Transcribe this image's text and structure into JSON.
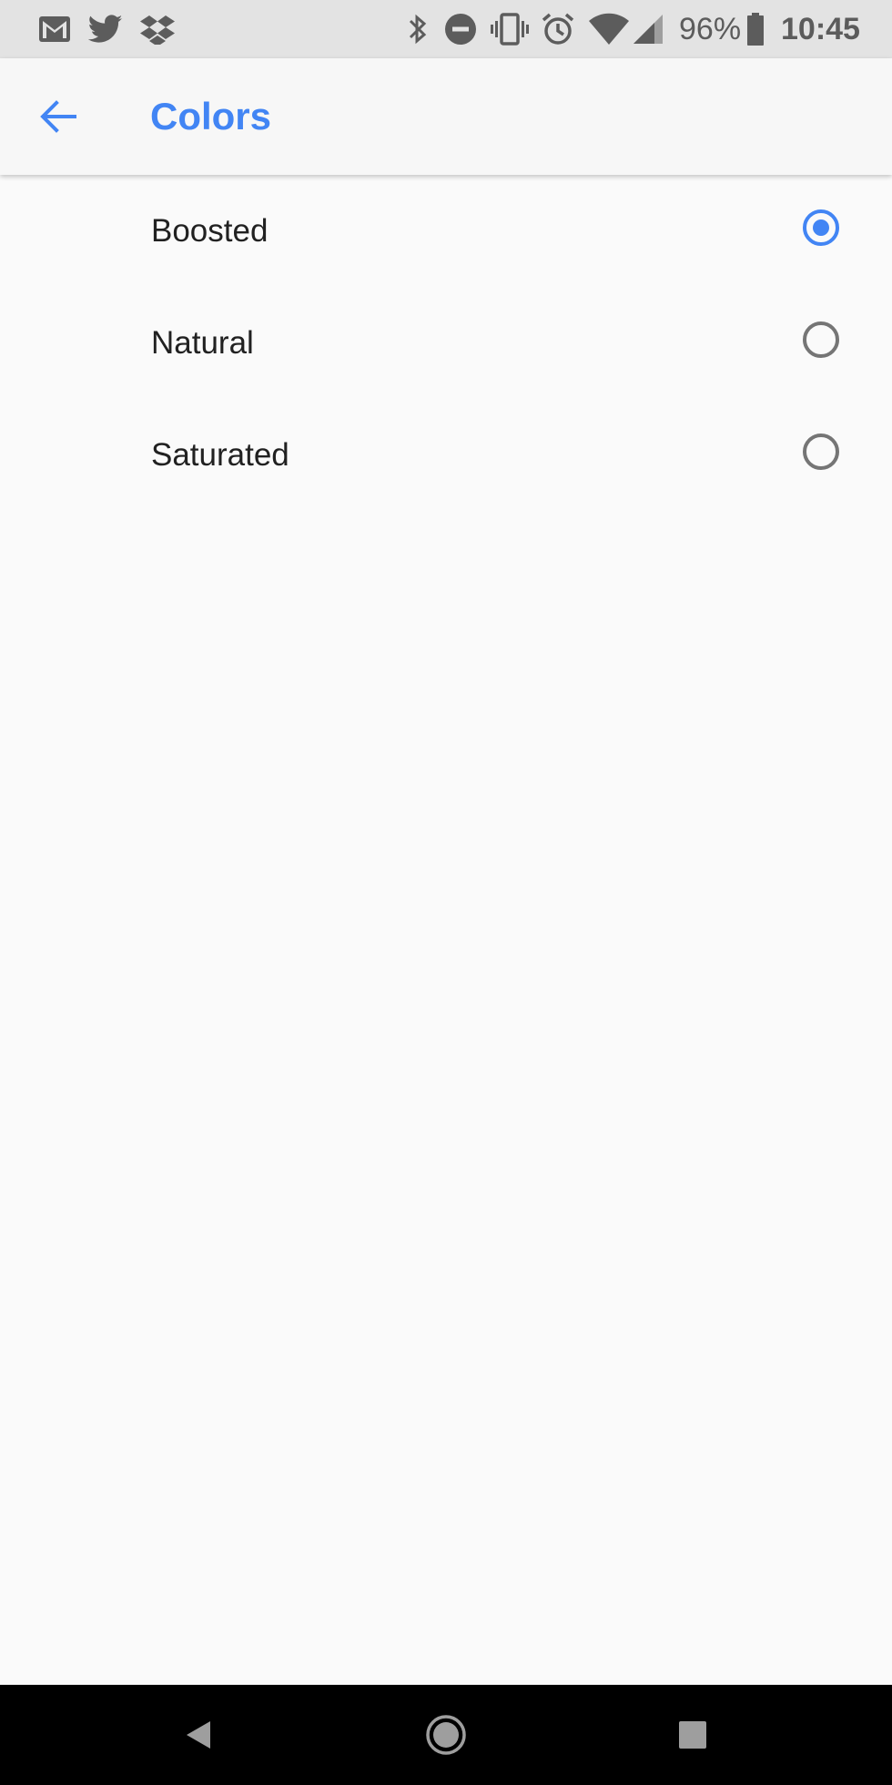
{
  "status_bar": {
    "left_icons": [
      "gmail-icon",
      "twitter-icon",
      "dropbox-icon"
    ],
    "right_icons": [
      "bluetooth-icon",
      "do-not-disturb-icon",
      "vibrate-icon",
      "alarm-icon",
      "wifi-icon",
      "cell-signal-icon"
    ],
    "battery_percent": "96%",
    "time": "10:45"
  },
  "app_bar": {
    "back_icon": "arrow-back-icon",
    "title": "Colors"
  },
  "options": [
    {
      "label": "Boosted",
      "selected": true
    },
    {
      "label": "Natural",
      "selected": false
    },
    {
      "label": "Saturated",
      "selected": false
    }
  ],
  "nav_bar": {
    "icons": [
      "nav-back-icon",
      "nav-home-icon",
      "nav-recents-icon"
    ]
  },
  "colors": {
    "accent": "#4285f4",
    "text_primary": "#212121",
    "radio_unchecked": "#757575",
    "status_bar_bg": "#e3e3e3",
    "nav_bar_bg": "#000000"
  }
}
